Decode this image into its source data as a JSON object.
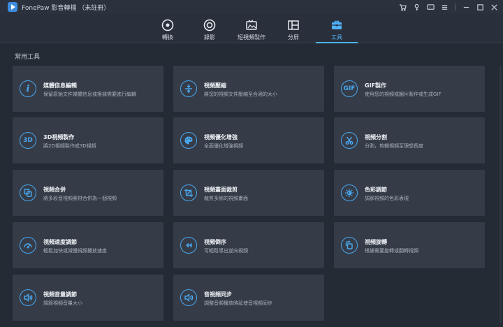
{
  "app": {
    "title": "FonePaw 影音轉檔 （未註冊）"
  },
  "nav": [
    {
      "label": "轉換",
      "icon": "convert-icon",
      "active": false
    },
    {
      "label": "錄影",
      "icon": "record-icon",
      "active": false
    },
    {
      "label": "短視頻製作",
      "icon": "mv-icon",
      "active": false
    },
    {
      "label": "分屏",
      "icon": "collage-icon",
      "active": false
    },
    {
      "label": "工具",
      "icon": "toolbox-icon",
      "active": true
    }
  ],
  "section_title": "常用工具",
  "tools": [
    {
      "title": "媒體信息編輯",
      "desc": "保留原始文件媒體信息或根據需要進行編輯",
      "icon": "info-icon"
    },
    {
      "title": "視頻壓縮",
      "desc": "將您的視頻文件壓縮至合適的大小",
      "icon": "compress-icon"
    },
    {
      "title": "GIF製作",
      "desc": "使用您的視頻或圖片製作或生成GIF",
      "icon": "gif-icon",
      "icon_text": "GIF"
    },
    {
      "title": "3D視頻製作",
      "desc": "將2D視頻製作成3D視頻",
      "icon": "3d-icon",
      "icon_text": "3D"
    },
    {
      "title": "視頻優化增強",
      "desc": "全面優化增強視頻",
      "icon": "palette-icon"
    },
    {
      "title": "視頻分割",
      "desc": "分割，剪輯視頻至理想長度",
      "icon": "scissors-icon"
    },
    {
      "title": "視頻合併",
      "desc": "將多段音視頻素材合併為一個視頻",
      "icon": "merge-icon"
    },
    {
      "title": "視頻畫面裁剪",
      "desc": "裁剪多餘的視頻畫面",
      "icon": "crop-icon"
    },
    {
      "title": "色彩調節",
      "desc": "調節視頻的色彩表現",
      "icon": "brightness-icon"
    },
    {
      "title": "視頻速度調節",
      "desc": "輕鬆加快或減慢視頻播放速度",
      "icon": "speed-icon"
    },
    {
      "title": "視頻倒序",
      "desc": "可輕鬆導出逆向視頻",
      "icon": "reverse-icon"
    },
    {
      "title": "視頻旋轉",
      "desc": "根據需要旋轉或翻轉視頻",
      "icon": "rotate-icon"
    },
    {
      "title": "視頻音量調節",
      "desc": "調節視頻音量大小",
      "icon": "volume-icon"
    },
    {
      "title": "音視頻同步",
      "desc": "調整音頻播放時延使音視頻同步",
      "icon": "sync-icon"
    }
  ],
  "colors": {
    "accent": "#4fb3ff",
    "card": "#353c48",
    "background": "#252b35"
  }
}
